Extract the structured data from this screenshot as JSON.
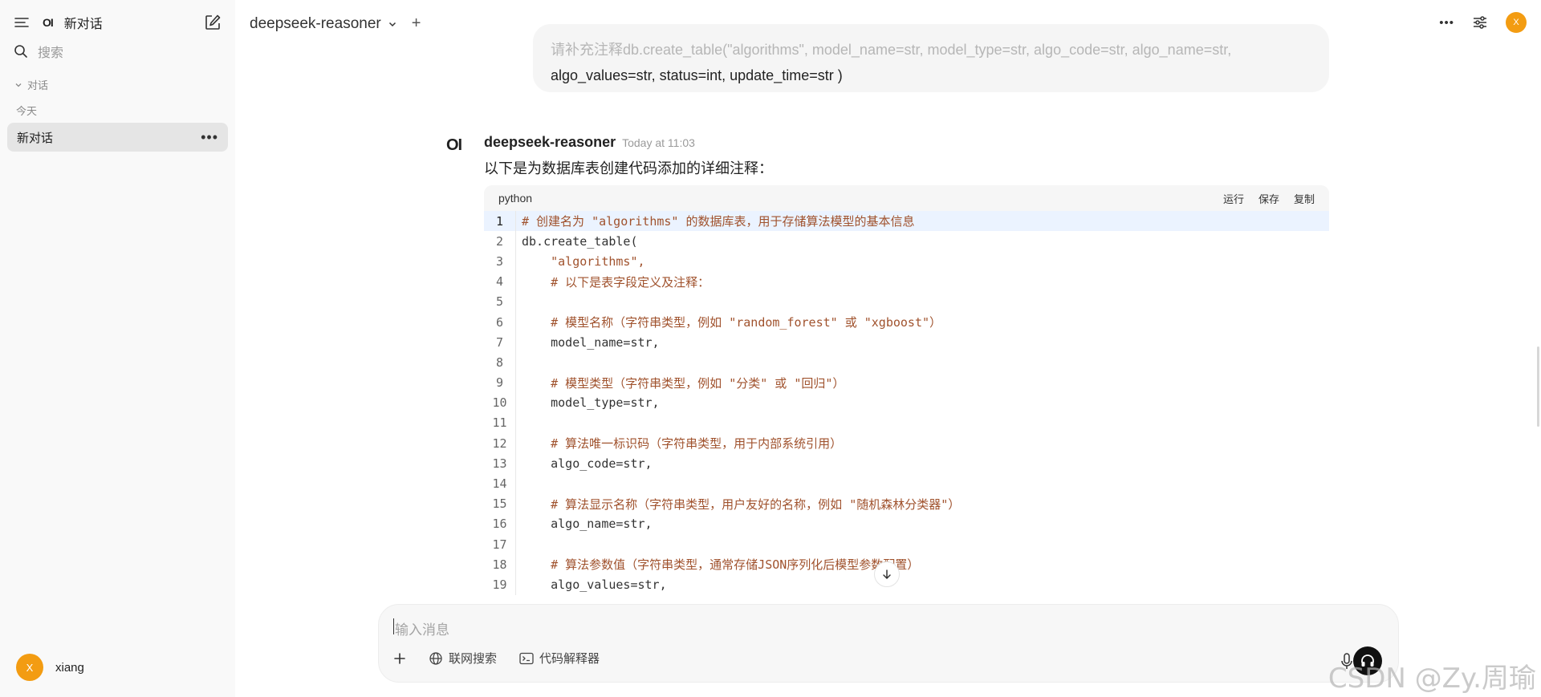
{
  "sidebar": {
    "new_chat_label": "新对话",
    "search_placeholder": "搜索",
    "section_label": "对话",
    "group_today": "今天",
    "active_chat": "新对话",
    "user_initial": "X",
    "user_name": "xiang"
  },
  "header": {
    "model_name": "deepseek-reasoner",
    "user_initial": "X"
  },
  "user_message": {
    "line1": "请补充注释db.create_table(\"algorithms\", model_name=str, model_type=str, algo_code=str, algo_name=str,",
    "line2": "algo_values=str, status=int, update_time=str )"
  },
  "assistant": {
    "logo": "OI",
    "name": "deepseek-reasoner",
    "time": "Today at 11:03",
    "intro": "以下是为数据库表创建代码添加的详细注释："
  },
  "code": {
    "language": "python",
    "actions": {
      "run": "运行",
      "save": "保存",
      "copy": "复制"
    },
    "lines": [
      "# 创建名为 \"algorithms\" 的数据库表，用于存储算法模型的基本信息",
      "db.create_table(",
      "    \"algorithms\",",
      "    # 以下是表字段定义及注释：",
      "",
      "    # 模型名称（字符串类型，例如 \"random_forest\" 或 \"xgboost\"）",
      "    model_name=str,",
      "",
      "    # 模型类型（字符串类型，例如 \"分类\" 或 \"回归\"）",
      "    model_type=str,",
      "",
      "    # 算法唯一标识码（字符串类型，用于内部系统引用）",
      "    algo_code=str,",
      "",
      "    # 算法显示名称（字符串类型，用户友好的名称，例如 \"随机森林分类器\"）",
      "    algo_name=str,",
      "",
      "    # 算法参数值（字符串类型，通常存储JSON序列化后模型参数配置）",
      "    algo_values=str,"
    ]
  },
  "input": {
    "placeholder": "输入消息",
    "web_search": "联网搜索",
    "code_interpreter": "代码解释器"
  },
  "watermark": "CSDN @Zy.周瑜"
}
